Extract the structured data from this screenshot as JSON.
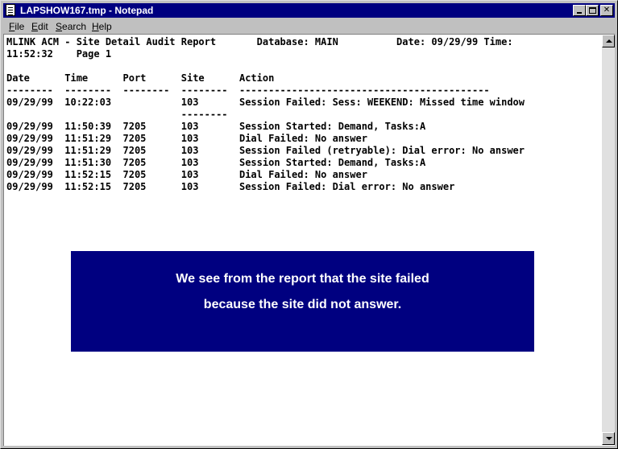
{
  "window": {
    "title": "LAPSHOW167.tmp - Notepad"
  },
  "menu": [
    {
      "accel": "F",
      "rest": "ile"
    },
    {
      "accel": "E",
      "rest": "dit"
    },
    {
      "accel": "S",
      "rest": "earch"
    },
    {
      "accel": "H",
      "rest": "elp"
    }
  ],
  "document": {
    "lines": [
      "MLINK ACM - Site Detail Audit Report       Database: MAIN          Date: 09/29/99 Time:",
      "11:52:32    Page 1",
      "",
      "Date      Time      Port      Site      Action",
      "--------  --------  --------  --------  -------------------------------------------",
      "09/29/99  10:22:03            103       Session Failed: Sess: WEEKEND: Missed time window",
      "                              --------",
      "09/29/99  11:50:39  7205      103       Session Started: Demand, Tasks:A",
      "09/29/99  11:51:29  7205      103       Dial Failed: No answer",
      "09/29/99  11:51:29  7205      103       Session Failed (retryable): Dial error: No answer",
      "09/29/99  11:51:30  7205      103       Session Started: Demand, Tasks:A",
      "09/29/99  11:52:15  7205      103       Dial Failed: No answer",
      "09/29/99  11:52:15  7205      103       Session Failed: Dial error: No answer"
    ]
  },
  "callout": {
    "line1": "We see from the report that the site failed",
    "line2": "because the site did not answer."
  }
}
